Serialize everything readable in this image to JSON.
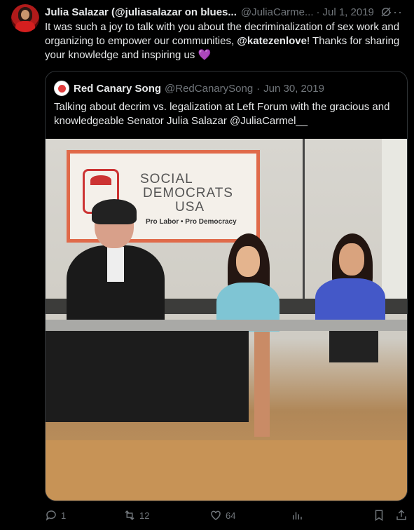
{
  "tweet": {
    "author_name": "Julia Salazar (@juliasalazar on blues...",
    "author_handle": "@JuliaCarme...",
    "separator": "·",
    "date": "Jul 1, 2019",
    "text_part1": "It was such a joy to talk with you about the decriminalization of sex work and organizing to empower our communities, ",
    "mention": "@katezenlove",
    "text_part2": "! Thanks for sharing your knowledge and inspiring us ",
    "emoji": "💜"
  },
  "quote": {
    "author_name": "Red Canary Song",
    "author_handle": "@RedCanarySong",
    "separator": "·",
    "date": "Jun 30, 2019",
    "text": "Talking about decrim vs. legalization at Left Forum with the gracious and knowledgeable Senator Julia Salazar @JuliaCarmel__"
  },
  "photo": {
    "banner_line1": "SOCIAL",
    "banner_line2": "DEMOCRATS",
    "banner_line3": "USA",
    "banner_tagline": "Pro Labor  •  Pro Democracy"
  },
  "actions": {
    "replies": "1",
    "reposts": "12",
    "likes": "64"
  },
  "icons": {
    "more": "more-icon",
    "grok": "grok-icon",
    "reply": "reply-icon",
    "repost": "repost-icon",
    "like": "like-icon",
    "views": "views-icon",
    "bookmark": "bookmark-icon",
    "share": "share-icon"
  }
}
